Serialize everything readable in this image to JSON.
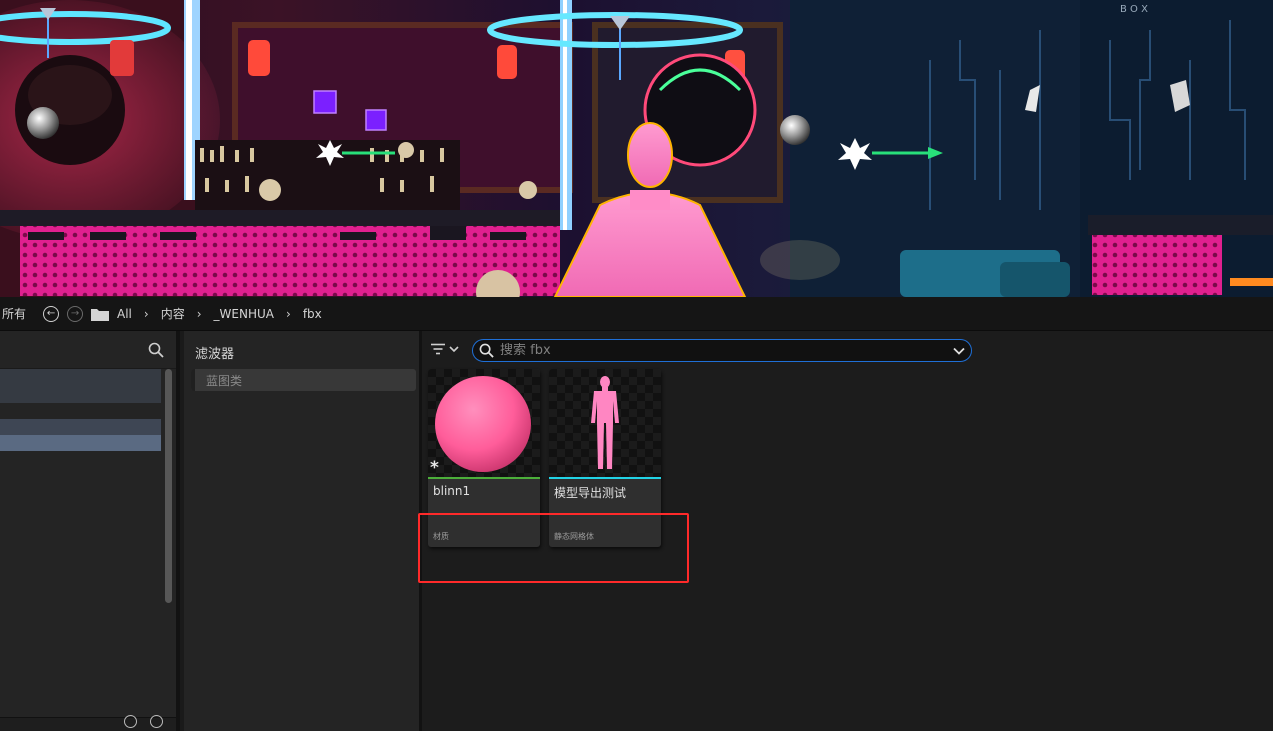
{
  "breadcrumb": {
    "root_label": "所有",
    "items": [
      "All",
      "内容",
      "_WENHUA",
      "fbx"
    ],
    "separator": "›"
  },
  "filters": {
    "title": "滤波器",
    "items": [
      "蓝图类"
    ]
  },
  "search": {
    "placeholder": "搜索 fbx",
    "value": ""
  },
  "assets": [
    {
      "name": "blinn1",
      "type": "材质",
      "stripe_color": "#4caf3a",
      "thumbnail": "sphere-material",
      "modified": true
    },
    {
      "name": "模型导出测试",
      "type": "静态网格体",
      "stripe_color": "#22d3e6",
      "thumbnail": "human-mesh",
      "modified": false
    }
  ],
  "colors": {
    "accent_blue": "#1f6fd6",
    "highlight_red": "#ff2a2a",
    "material_pink": "#ff5d9a",
    "mesh_pink": "#ff86c2"
  },
  "icons": {
    "back": "back-arrow-icon",
    "forward": "forward-arrow-icon",
    "folder": "folder-icon",
    "search": "search-icon",
    "filter": "filter-icon",
    "dropdown": "chevron-down-icon"
  }
}
